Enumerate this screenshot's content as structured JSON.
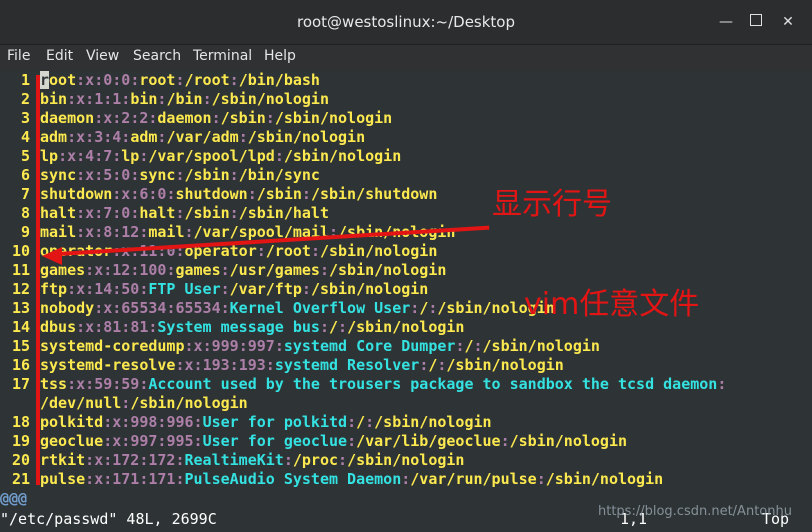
{
  "window": {
    "title": "root@westoslinux:~/Desktop",
    "controls": [
      "minimize",
      "maximize",
      "close"
    ]
  },
  "menu": [
    "File",
    "Edit",
    "View",
    "Search",
    "Terminal",
    "Help"
  ],
  "lines": [
    {
      "n": "1",
      "f": [
        "root",
        "x",
        "0",
        "0",
        "root",
        "/root",
        "/bin/bash"
      ],
      "cursor": true
    },
    {
      "n": "2",
      "f": [
        "bin",
        "x",
        "1",
        "1",
        "bin",
        "/bin",
        "/sbin/nologin"
      ]
    },
    {
      "n": "3",
      "f": [
        "daemon",
        "x",
        "2",
        "2",
        "daemon",
        "/sbin",
        "/sbin/nologin"
      ]
    },
    {
      "n": "4",
      "f": [
        "adm",
        "x",
        "3",
        "4",
        "adm",
        "/var/adm",
        "/sbin/nologin"
      ]
    },
    {
      "n": "5",
      "f": [
        "lp",
        "x",
        "4",
        "7",
        "lp",
        "/var/spool/lpd",
        "/sbin/nologin"
      ]
    },
    {
      "n": "6",
      "f": [
        "sync",
        "x",
        "5",
        "0",
        "sync",
        "/sbin",
        "/bin/sync"
      ]
    },
    {
      "n": "7",
      "f": [
        "shutdown",
        "x",
        "6",
        "0",
        "shutdown",
        "/sbin",
        "/sbin/shutdown"
      ]
    },
    {
      "n": "8",
      "f": [
        "halt",
        "x",
        "7",
        "0",
        "halt",
        "/sbin",
        "/sbin/halt"
      ]
    },
    {
      "n": "9",
      "f": [
        "mail",
        "x",
        "8",
        "12",
        "mail",
        "/var/spool/mail",
        "/sbin/nologin"
      ]
    },
    {
      "n": "10",
      "f": [
        "operator",
        "x",
        "11",
        "0",
        "operator",
        "/root",
        "/sbin/nologin"
      ]
    },
    {
      "n": "11",
      "f": [
        "games",
        "x",
        "12",
        "100",
        "games",
        "/usr/games",
        "/sbin/nologin"
      ]
    },
    {
      "n": "12",
      "f": [
        "ftp",
        "x",
        "14",
        "50",
        "FTP User",
        "/var/ftp",
        "/sbin/nologin"
      ]
    },
    {
      "n": "13",
      "f": [
        "nobody",
        "x",
        "65534",
        "65534",
        "Kernel Overflow User",
        "/",
        "/sbin/nologin"
      ]
    },
    {
      "n": "14",
      "f": [
        "dbus",
        "x",
        "81",
        "81",
        "System message bus",
        "/",
        "/sbin/nologin"
      ]
    },
    {
      "n": "15",
      "f": [
        "systemd-coredump",
        "x",
        "999",
        "997",
        "systemd Core Dumper",
        "/",
        "/sbin/nologin"
      ]
    },
    {
      "n": "16",
      "f": [
        "systemd-resolve",
        "x",
        "193",
        "193",
        "systemd Resolver",
        "/",
        "/sbin/nologin"
      ]
    },
    {
      "n": "17",
      "f": [
        "tss",
        "x",
        "59",
        "59",
        "Account used by the trousers package to sandbox the tcsd daemon",
        "/dev/null",
        "/sbin/nologin"
      ],
      "wrap": true
    },
    {
      "n": "18",
      "f": [
        "polkitd",
        "x",
        "998",
        "996",
        "User for polkitd",
        "/",
        "/sbin/nologin"
      ]
    },
    {
      "n": "19",
      "f": [
        "geoclue",
        "x",
        "997",
        "995",
        "User for geoclue",
        "/var/lib/geoclue",
        "/sbin/nologin"
      ]
    },
    {
      "n": "20",
      "f": [
        "rtkit",
        "x",
        "172",
        "172",
        "RealtimeKit",
        "/proc",
        "/sbin/nologin"
      ]
    },
    {
      "n": "21",
      "f": [
        "pulse",
        "x",
        "171",
        "171",
        "PulseAudio System Daemon",
        "/var/run/pulse",
        "/sbin/nologin"
      ]
    }
  ],
  "tilde_line": "@@@",
  "status": {
    "file": "\"/etc/passwd\" 48L, 2699C",
    "position": "1,1",
    "scroll": "Top"
  },
  "annotations": {
    "line_numbers_label": "显示行号",
    "vim_label": "vim任意文件"
  },
  "watermark": "https://blog.csdn.net/Antonhu",
  "colors": {
    "background": "#2e3436",
    "username": "#fce94f",
    "separator": "#ad7fa8",
    "field_cyan": "#34e2e2",
    "annotation": "#e31414"
  }
}
